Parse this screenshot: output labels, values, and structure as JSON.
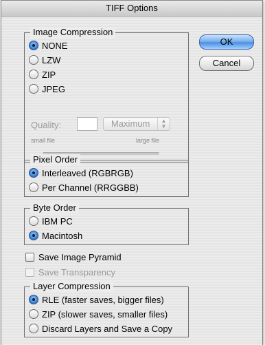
{
  "window": {
    "title": "TIFF Options"
  },
  "buttons": {
    "ok": "OK",
    "cancel": "Cancel"
  },
  "image_compression": {
    "label": "Image Compression",
    "options": [
      "NONE",
      "LZW",
      "ZIP",
      "JPEG"
    ],
    "selected": "NONE",
    "quality": {
      "label": "Quality:",
      "value": "",
      "preset": "Maximum",
      "small_label": "small file",
      "large_label": "large file"
    }
  },
  "pixel_order": {
    "label": "Pixel Order",
    "options": [
      "Interleaved (RGBRGB)",
      "Per Channel (RRGGBB)"
    ],
    "selected": "Interleaved (RGBRGB)"
  },
  "byte_order": {
    "label": "Byte Order",
    "options": [
      "IBM PC",
      "Macintosh"
    ],
    "selected": "Macintosh"
  },
  "checkboxes": {
    "save_pyramid": {
      "label": "Save Image Pyramid",
      "checked": false,
      "enabled": true
    },
    "save_transparency": {
      "label": "Save Transparency",
      "checked": false,
      "enabled": false
    }
  },
  "layer_compression": {
    "label": "Layer Compression",
    "options": [
      "RLE (faster saves, bigger files)",
      "ZIP (slower saves, smaller files)",
      "Discard Layers and Save a Copy"
    ],
    "selected": "RLE (faster saves, bigger files)"
  },
  "colors": {
    "accent": "#2f78d0",
    "disabled_text": "#9a9a9a"
  }
}
